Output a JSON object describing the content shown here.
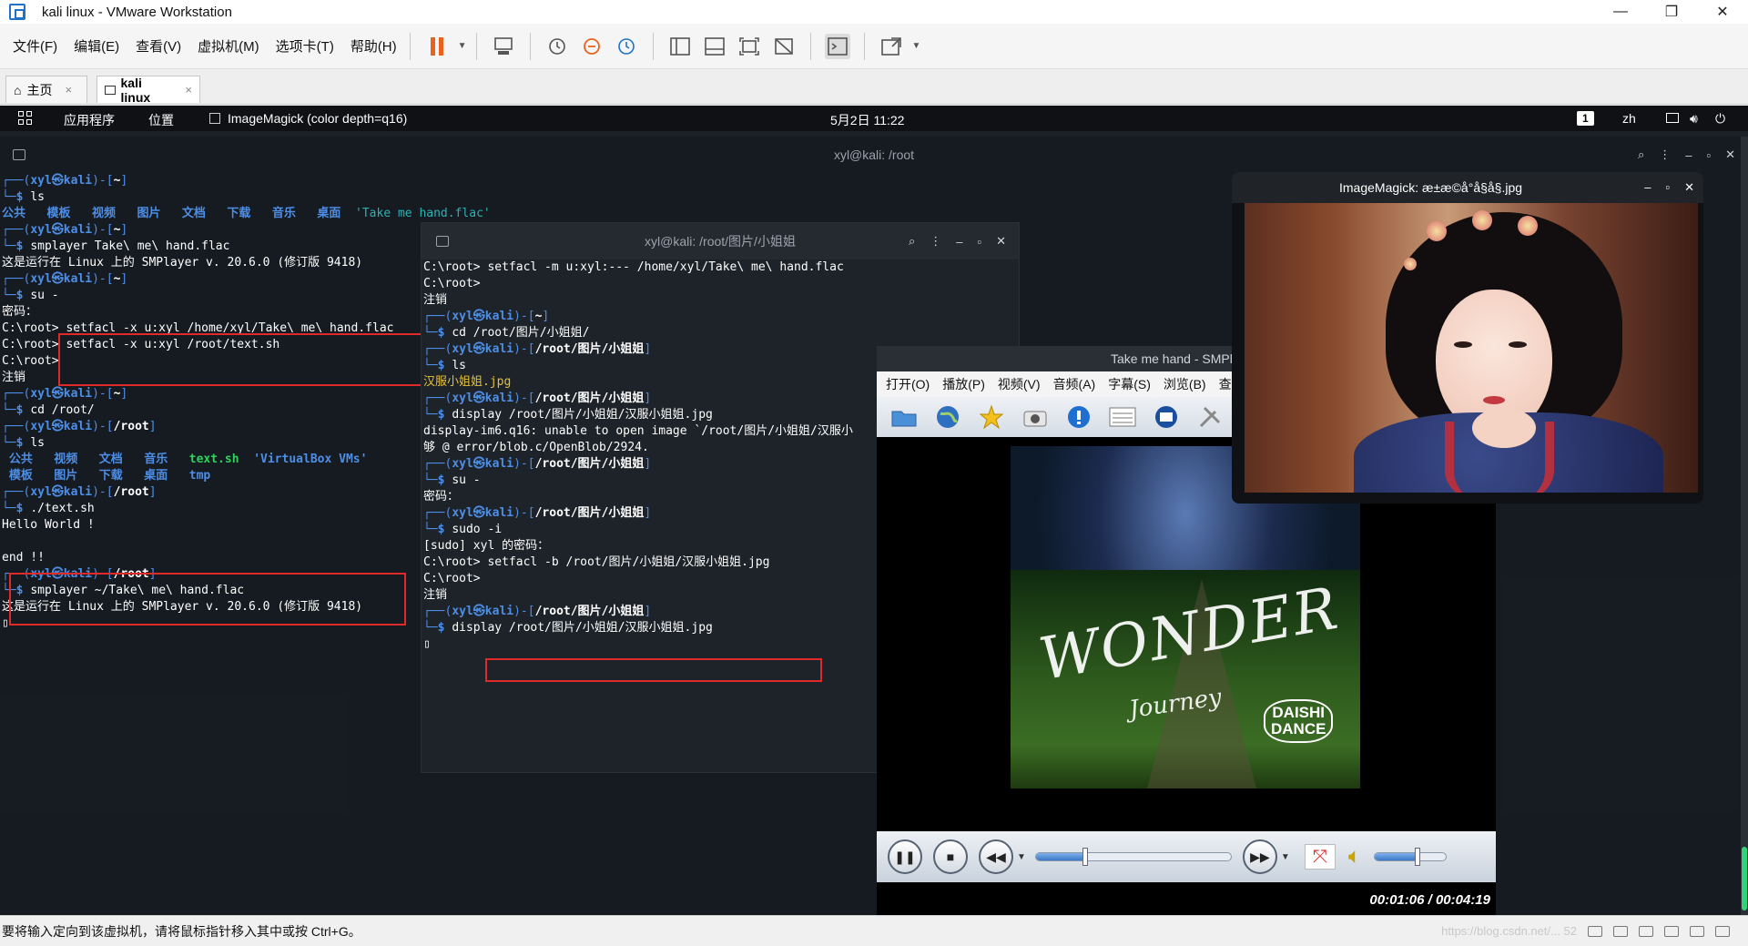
{
  "window": {
    "title": "kali linux - VMware Workstation",
    "min": "—",
    "max": "❐",
    "close": "✕"
  },
  "menubar": {
    "items": [
      "文件(F)",
      "编辑(E)",
      "查看(V)",
      "虚拟机(M)",
      "选项卡(T)",
      "帮助(H)"
    ]
  },
  "tabs": {
    "home": "主页",
    "vm": "kali linux",
    "close": "×"
  },
  "kali_panel": {
    "apps": "应用程序",
    "places": "位置",
    "active_window": "ImageMagick (color depth=q16)",
    "clock": "5月2日 11:22",
    "workspace": "1",
    "lang": "zh"
  },
  "term1": {
    "title": "xyl@kali: /root",
    "lines": [
      [
        {
          "t": "┌──(",
          "c": "c-blue"
        },
        {
          "t": "xyl㉿kali",
          "c": "c-bb"
        },
        {
          "t": ")-[",
          "c": "c-blue"
        },
        {
          "t": "~",
          "c": "c-white-b"
        },
        {
          "t": "]",
          "c": "c-blue"
        }
      ],
      [
        {
          "t": "└─",
          "c": "c-blue"
        },
        {
          "t": "$ ",
          "c": "c-bb"
        },
        {
          "t": "ls",
          "c": ""
        }
      ],
      [
        {
          "t": "公共   模板   视频   图片   文档   下载   音乐   桌面  ",
          "c": "c-bb"
        },
        {
          "t": "'Take me hand.flac'",
          "c": "c-cyan"
        }
      ],
      [
        {
          "t": "┌──(",
          "c": "c-blue"
        },
        {
          "t": "xyl㉿kali",
          "c": "c-bb"
        },
        {
          "t": ")-[",
          "c": "c-blue"
        },
        {
          "t": "~",
          "c": "c-white-b"
        },
        {
          "t": "]",
          "c": "c-blue"
        }
      ],
      [
        {
          "t": "└─",
          "c": "c-blue"
        },
        {
          "t": "$ ",
          "c": "c-bb"
        },
        {
          "t": "smplayer Take\\ me\\ hand.flac",
          "c": ""
        }
      ],
      [
        {
          "t": "这是运行在 Linux 上的 SMPlayer v. 20.6.0 (修订版 9418)",
          "c": ""
        }
      ],
      [
        {
          "t": "┌──(",
          "c": "c-blue"
        },
        {
          "t": "xyl㉿kali",
          "c": "c-bb"
        },
        {
          "t": ")-[",
          "c": "c-blue"
        },
        {
          "t": "~",
          "c": "c-white-b"
        },
        {
          "t": "]",
          "c": "c-blue"
        }
      ],
      [
        {
          "t": "└─",
          "c": "c-blue"
        },
        {
          "t": "$ ",
          "c": "c-bb"
        },
        {
          "t": "su -",
          "c": ""
        }
      ],
      [
        {
          "t": "密码：",
          "c": ""
        }
      ],
      [
        {
          "t": "C:\\root> setfacl -x u:xyl /home/xyl/Take\\ me\\ hand.flac",
          "c": ""
        }
      ],
      [
        {
          "t": "C:\\root> setfacl -x u:xyl /root/text.sh",
          "c": ""
        }
      ],
      [
        {
          "t": "C:\\root>",
          "c": ""
        }
      ],
      [
        {
          "t": "注销",
          "c": ""
        }
      ],
      [
        {
          "t": "┌──(",
          "c": "c-blue"
        },
        {
          "t": "xyl㉿kali",
          "c": "c-bb"
        },
        {
          "t": ")-[",
          "c": "c-blue"
        },
        {
          "t": "~",
          "c": "c-white-b"
        },
        {
          "t": "]",
          "c": "c-blue"
        }
      ],
      [
        {
          "t": "└─",
          "c": "c-blue"
        },
        {
          "t": "$ ",
          "c": "c-bb"
        },
        {
          "t": "cd /root/",
          "c": ""
        }
      ],
      [
        {
          "t": "┌──(",
          "c": "c-blue"
        },
        {
          "t": "xyl㉿kali",
          "c": "c-bb"
        },
        {
          "t": ")-[",
          "c": "c-blue"
        },
        {
          "t": "/root",
          "c": "c-white-b"
        },
        {
          "t": "]",
          "c": "c-blue"
        }
      ],
      [
        {
          "t": "└─",
          "c": "c-blue"
        },
        {
          "t": "$ ",
          "c": "c-bb"
        },
        {
          "t": "ls",
          "c": ""
        }
      ],
      [
        {
          "t": " 公共   视频   文档   音乐   ",
          "c": "c-bb"
        },
        {
          "t": "text.sh",
          "c": "c-green"
        },
        {
          "t": "  ",
          "c": ""
        },
        {
          "t": "'VirtualBox VMs'",
          "c": "c-bb"
        }
      ],
      [
        {
          "t": " 模板   图片   下载   桌面   tmp",
          "c": "c-bb"
        }
      ],
      [
        {
          "t": "┌──(",
          "c": "c-blue"
        },
        {
          "t": "xyl㉿kali",
          "c": "c-bb"
        },
        {
          "t": ")-[",
          "c": "c-blue"
        },
        {
          "t": "/root",
          "c": "c-white-b"
        },
        {
          "t": "]",
          "c": "c-blue"
        }
      ],
      [
        {
          "t": "└─",
          "c": "c-blue"
        },
        {
          "t": "$ ",
          "c": "c-bb"
        },
        {
          "t": "./text.sh",
          "c": ""
        }
      ],
      [
        {
          "t": "Hello World !",
          "c": ""
        }
      ],
      [
        {
          "t": "",
          "c": ""
        }
      ],
      [
        {
          "t": "end !!",
          "c": ""
        }
      ],
      [
        {
          "t": "┌──(",
          "c": "c-blue"
        },
        {
          "t": "xyl㉿kali",
          "c": "c-bb"
        },
        {
          "t": ")-[",
          "c": "c-blue"
        },
        {
          "t": "/root",
          "c": "c-white-b"
        },
        {
          "t": "]",
          "c": "c-blue"
        }
      ],
      [
        {
          "t": "└─",
          "c": "c-blue"
        },
        {
          "t": "$ ",
          "c": "c-bb"
        },
        {
          "t": "smplayer ~/Take\\ me\\ hand.flac",
          "c": ""
        }
      ],
      [
        {
          "t": "这是运行在 Linux 上的 SMPlayer v. 20.6.0 (修订版 9418)",
          "c": ""
        }
      ],
      [
        {
          "t": "▯",
          "c": ""
        }
      ]
    ]
  },
  "term2": {
    "title": "xyl@kali: /root/图片/小姐姐",
    "lines": [
      [
        {
          "t": "C:\\root> setfacl -m u:xyl:--- /home/xyl/Take\\ me\\ hand.flac",
          "c": ""
        }
      ],
      [
        {
          "t": "C:\\root>",
          "c": ""
        }
      ],
      [
        {
          "t": "注销",
          "c": ""
        }
      ],
      [
        {
          "t": "┌──(",
          "c": "c-blue"
        },
        {
          "t": "xyl㉿kali",
          "c": "c-bb"
        },
        {
          "t": ")-[",
          "c": "c-blue"
        },
        {
          "t": "~",
          "c": "c-white-b"
        },
        {
          "t": "]",
          "c": "c-blue"
        }
      ],
      [
        {
          "t": "└─",
          "c": "c-blue"
        },
        {
          "t": "$ ",
          "c": "c-bb"
        },
        {
          "t": "cd /root/图片/小姐姐/",
          "c": ""
        }
      ],
      [
        {
          "t": "┌──(",
          "c": "c-blue"
        },
        {
          "t": "xyl㉿kali",
          "c": "c-bb"
        },
        {
          "t": ")-[",
          "c": "c-blue"
        },
        {
          "t": "/root/图片/小姐姐",
          "c": "c-white-b"
        },
        {
          "t": "]",
          "c": "c-blue"
        }
      ],
      [
        {
          "t": "└─",
          "c": "c-blue"
        },
        {
          "t": "$ ",
          "c": "c-bb"
        },
        {
          "t": "ls",
          "c": ""
        }
      ],
      [
        {
          "t": "汉服小姐姐.jpg",
          "c": "c-yellow"
        }
      ],
      [
        {
          "t": "┌──(",
          "c": "c-blue"
        },
        {
          "t": "xyl㉿kali",
          "c": "c-bb"
        },
        {
          "t": ")-[",
          "c": "c-blue"
        },
        {
          "t": "/root/图片/小姐姐",
          "c": "c-white-b"
        },
        {
          "t": "]",
          "c": "c-blue"
        }
      ],
      [
        {
          "t": "└─",
          "c": "c-blue"
        },
        {
          "t": "$ ",
          "c": "c-bb"
        },
        {
          "t": "display /root/图片/小姐姐/汉服小姐姐.jpg",
          "c": ""
        }
      ],
      [
        {
          "t": "display-im6.q16: unable to open image `/root/图片/小姐姐/汉服小",
          "c": ""
        }
      ],
      [
        {
          "t": "够 @ error/blob.c/OpenBlob/2924.",
          "c": ""
        }
      ],
      [
        {
          "t": "┌──(",
          "c": "c-blue"
        },
        {
          "t": "xyl㉿kali",
          "c": "c-bb"
        },
        {
          "t": ")-[",
          "c": "c-blue"
        },
        {
          "t": "/root/图片/小姐姐",
          "c": "c-white-b"
        },
        {
          "t": "]",
          "c": "c-blue"
        }
      ],
      [
        {
          "t": "└─",
          "c": "c-blue"
        },
        {
          "t": "$ ",
          "c": "c-bb"
        },
        {
          "t": "su -",
          "c": ""
        }
      ],
      [
        {
          "t": "密码：",
          "c": ""
        }
      ],
      [
        {
          "t": "┌──(",
          "c": "c-blue"
        },
        {
          "t": "xyl㉿kali",
          "c": "c-bb"
        },
        {
          "t": ")-[",
          "c": "c-blue"
        },
        {
          "t": "/root/图片/小姐姐",
          "c": "c-white-b"
        },
        {
          "t": "]",
          "c": "c-blue"
        }
      ],
      [
        {
          "t": "└─",
          "c": "c-blue"
        },
        {
          "t": "$ ",
          "c": "c-bb"
        },
        {
          "t": "sudo -i",
          "c": ""
        }
      ],
      [
        {
          "t": "[sudo] xyl 的密码：",
          "c": ""
        }
      ],
      [
        {
          "t": "C:\\root> setfacl -b /root/图片/小姐姐/汉服小姐姐.jpg",
          "c": ""
        }
      ],
      [
        {
          "t": "C:\\root>",
          "c": ""
        }
      ],
      [
        {
          "t": "注销",
          "c": ""
        }
      ],
      [
        {
          "t": "┌──(",
          "c": "c-blue"
        },
        {
          "t": "xyl㉿kali",
          "c": "c-bb"
        },
        {
          "t": ")-[",
          "c": "c-blue"
        },
        {
          "t": "/root/图片/小姐姐",
          "c": "c-white-b"
        },
        {
          "t": "]",
          "c": "c-blue"
        }
      ],
      [
        {
          "t": "└─",
          "c": "c-blue"
        },
        {
          "t": "$ ",
          "c": "c-bb"
        },
        {
          "t": "display /root/图片/小姐姐/汉服小姐姐.jpg",
          "c": ""
        }
      ],
      [
        {
          "t": "▯",
          "c": ""
        }
      ]
    ]
  },
  "smplayer": {
    "title": "Take me hand - SMPla",
    "menu": [
      "打开(O)",
      "播放(P)",
      "视频(V)",
      "音频(A)",
      "字幕(S)",
      "浏览(B)",
      "查"
    ],
    "cover_text": {
      "main": "WONDER",
      "sub": "Journey",
      "artist_line1": "DAISHI",
      "artist_line2": "DANCE"
    },
    "time": "00:01:06 / 00:04:19",
    "progress": 0.255,
    "volume": 0.6
  },
  "imagemagick": {
    "title": "ImageMagick: æ±æ©å°å§å§.jpg",
    "min": "–",
    "max": "▫",
    "close": "✕"
  },
  "status": {
    "text": "要将输入定向到该虚拟机，请将鼠标指针移入其中或按 Ctrl+G。",
    "watermark": "https://blog.csdn.net/... 52"
  }
}
